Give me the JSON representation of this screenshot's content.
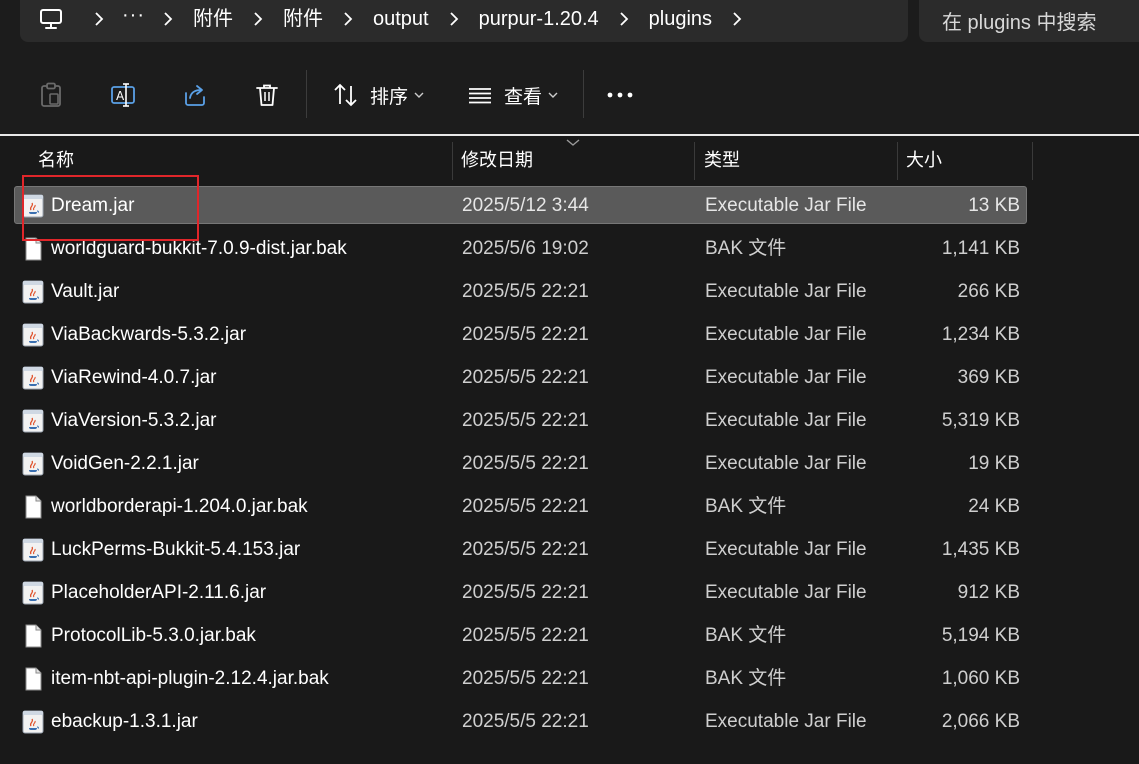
{
  "address_bar": {
    "more": "···",
    "path": [
      "附件",
      "附件",
      "output",
      "purpur-1.20.4",
      "plugins"
    ]
  },
  "search": {
    "placeholder": "在 plugins 中搜索"
  },
  "toolbar": {
    "sort_label": "排序",
    "view_label": "查看"
  },
  "columns": {
    "name": "名称",
    "modified": "修改日期",
    "type": "类型",
    "size": "大小"
  },
  "files": [
    {
      "name": "Dream.jar",
      "modified": "2025/5/12 3:44",
      "type": "Executable Jar File",
      "size": "13 KB",
      "icon": "java-jar-icon"
    },
    {
      "name": "worldguard-bukkit-7.0.9-dist.jar.bak",
      "modified": "2025/5/6 19:02",
      "type": "BAK 文件",
      "size": "1,141 KB",
      "icon": "blank-file-icon"
    },
    {
      "name": "Vault.jar",
      "modified": "2025/5/5 22:21",
      "type": "Executable Jar File",
      "size": "266 KB",
      "icon": "java-jar-icon"
    },
    {
      "name": "ViaBackwards-5.3.2.jar",
      "modified": "2025/5/5 22:21",
      "type": "Executable Jar File",
      "size": "1,234 KB",
      "icon": "java-jar-icon"
    },
    {
      "name": "ViaRewind-4.0.7.jar",
      "modified": "2025/5/5 22:21",
      "type": "Executable Jar File",
      "size": "369 KB",
      "icon": "java-jar-icon"
    },
    {
      "name": "ViaVersion-5.3.2.jar",
      "modified": "2025/5/5 22:21",
      "type": "Executable Jar File",
      "size": "5,319 KB",
      "icon": "java-jar-icon"
    },
    {
      "name": "VoidGen-2.2.1.jar",
      "modified": "2025/5/5 22:21",
      "type": "Executable Jar File",
      "size": "19 KB",
      "icon": "java-jar-icon"
    },
    {
      "name": "worldborderapi-1.204.0.jar.bak",
      "modified": "2025/5/5 22:21",
      "type": "BAK 文件",
      "size": "24 KB",
      "icon": "blank-file-icon"
    },
    {
      "name": "LuckPerms-Bukkit-5.4.153.jar",
      "modified": "2025/5/5 22:21",
      "type": "Executable Jar File",
      "size": "1,435 KB",
      "icon": "java-jar-icon"
    },
    {
      "name": "PlaceholderAPI-2.11.6.jar",
      "modified": "2025/5/5 22:21",
      "type": "Executable Jar File",
      "size": "912 KB",
      "icon": "java-jar-icon"
    },
    {
      "name": "ProtocolLib-5.3.0.jar.bak",
      "modified": "2025/5/5 22:21",
      "type": "BAK 文件",
      "size": "5,194 KB",
      "icon": "blank-file-icon"
    },
    {
      "name": "item-nbt-api-plugin-2.12.4.jar.bak",
      "modified": "2025/5/5 22:21",
      "type": "BAK 文件",
      "size": "1,060 KB",
      "icon": "blank-file-icon"
    },
    {
      "name": "ebackup-1.3.1.jar",
      "modified": "2025/5/5 22:21",
      "type": "Executable Jar File",
      "size": "2,066 KB",
      "icon": "java-jar-icon"
    }
  ],
  "selected_index": 0,
  "colors": {
    "background": "#191919",
    "panel": "#2b2b2b",
    "selected_row": "#5a5a5a",
    "highlight": "#e0262a"
  }
}
